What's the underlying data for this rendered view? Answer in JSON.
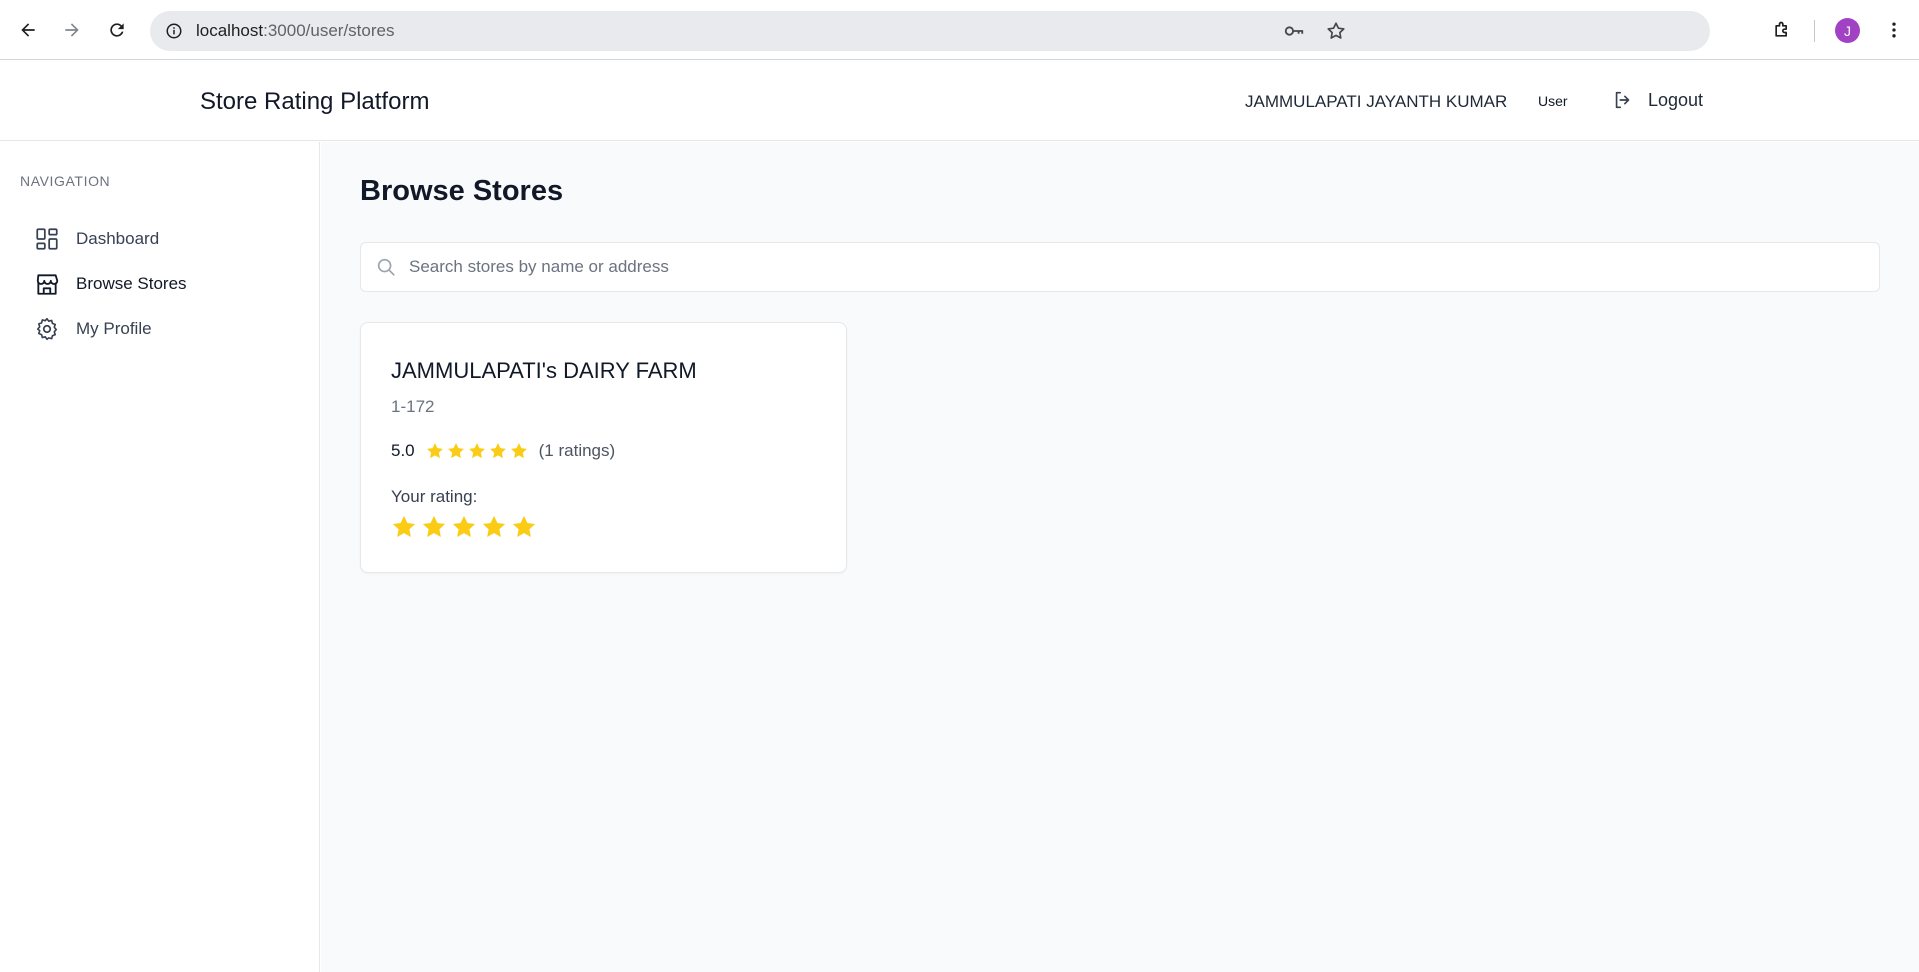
{
  "browser": {
    "url_host": "localhost",
    "url_path": ":3000/user/stores",
    "profile_initial": "J"
  },
  "header": {
    "brand": "Store Rating Platform",
    "user_name": "JAMMULAPATI JAYANTH KUMAR",
    "user_role": "User",
    "logout_label": "Logout"
  },
  "sidebar": {
    "heading": "NAVIGATION",
    "items": [
      {
        "label": "Dashboard",
        "icon": "dashboard-icon"
      },
      {
        "label": "Browse Stores",
        "icon": "store-icon",
        "active": true
      },
      {
        "label": "My Profile",
        "icon": "gear-icon"
      }
    ]
  },
  "main": {
    "title": "Browse Stores",
    "search": {
      "placeholder": "Search stores by name or address",
      "value": ""
    },
    "stores": [
      {
        "name": "JAMMULAPATI's DAIRY FARM",
        "address": "1-172",
        "avg_rating": "5.0",
        "rating_value": 5,
        "ratings_count": "(1 ratings)",
        "your_rating_label": "Your rating:",
        "your_rating": 5
      }
    ]
  },
  "colors": {
    "star": "#facc15",
    "avatar": "#a142c4",
    "page_bg": "#f9fafb",
    "border": "#e5e7eb"
  }
}
